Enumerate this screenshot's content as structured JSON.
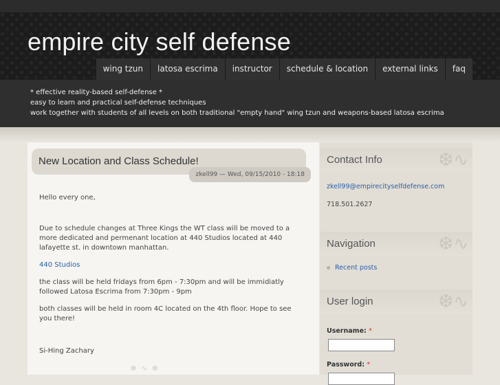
{
  "site": {
    "title": "empire city self defense",
    "tagline": [
      "* effective reality-based self-defense *",
      "easy to learn and practical self-defense techniques",
      "work together with students of all levels on both traditional \"empty hand\" wing tzun and weapons-based latosa escrima"
    ]
  },
  "nav": {
    "items": [
      {
        "label": "wing tzun"
      },
      {
        "label": "latosa escrima"
      },
      {
        "label": "instructor"
      },
      {
        "label": "schedule & location"
      },
      {
        "label": "external links"
      },
      {
        "label": "faq"
      }
    ]
  },
  "node": {
    "title": "New Location and Class Schedule!",
    "submitted": "zkell99 — Wed, 09/15/2010 - 18:18",
    "paragraphs": [
      "Hello every one,",
      "Due to schedule changes at Three Kings the WT class will be moved to a more dedicated and permenant location at 440 Studios located at 440 lafayette st. in downtown manhattan.",
      "440 Studios",
      "the class will be held fridays from 6pm - 7:30pm and will be immidiatly followed Latosa Escrima from 7:30pm - 9pm",
      "both classes will be held in room 4C located on the 4th floor.  Hope to see you there!",
      "Si-Hing Zachary"
    ]
  },
  "sidebar": {
    "contact": {
      "title": "Contact Info",
      "email": "zkell99@empirecityselfdefense.com",
      "phone": "718.501.2627"
    },
    "navigation": {
      "title": "Navigation",
      "items": [
        {
          "label": "Recent posts"
        }
      ]
    },
    "login": {
      "title": "User login",
      "username_label": "Username:",
      "password_label": "Password:",
      "required_mark": "*"
    }
  },
  "colors": {
    "header_bg": "#1c1c1c",
    "nav_bg": "#313131",
    "tagline_bg": "#2f2f2f",
    "page_bg": "#e9e6df",
    "content_bg": "#f6f5f2",
    "link": "#2a5ea8"
  },
  "icons": {
    "block_ornament": "swirl-ornament",
    "list_bullet": "dot-bullet"
  }
}
